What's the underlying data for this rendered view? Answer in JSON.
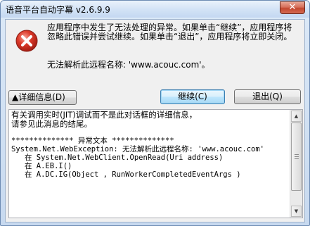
{
  "window": {
    "title": "语音平台自动字幕 v2.6.9.9",
    "close_glyph": "✕"
  },
  "message": {
    "text": "应用程序中发生了无法处理的异常。如果单击“继续”，应用程序将忽略此错误并尝试继续。如果单击“退出”，应用程序将立即关闭。",
    "host_line": "无法解析此远程名称: 'www.acouc.com'。"
  },
  "buttons": {
    "details_label": "▲详细信息(D)",
    "continue_label": "继续(C)",
    "quit_label": "退出(Q)"
  },
  "details": {
    "line1": "有关调用实时(JIT)调试而不是此对话框的详细信息，",
    "line2": "请参见此消息的结尾。",
    "line3": "************** 异常文本 **************",
    "line4": "System.Net.WebException: 无法解析此远程名称: 'www.acouc.com'",
    "line5": "   在 System.Net.WebClient.OpenRead(Uri address)",
    "line6": "   在 A.EB.I()",
    "line7": "   在 A.DC.IG(Object , RunWorkerCompletedEventArgs )"
  },
  "icons": {
    "error": "error-icon",
    "scroll_up": "scroll-up-icon",
    "scroll_down": "scroll-down-icon"
  },
  "colors": {
    "error_red": "#c8281c",
    "title_bar": "#d3e3f6",
    "close_red": "#c3462f"
  }
}
